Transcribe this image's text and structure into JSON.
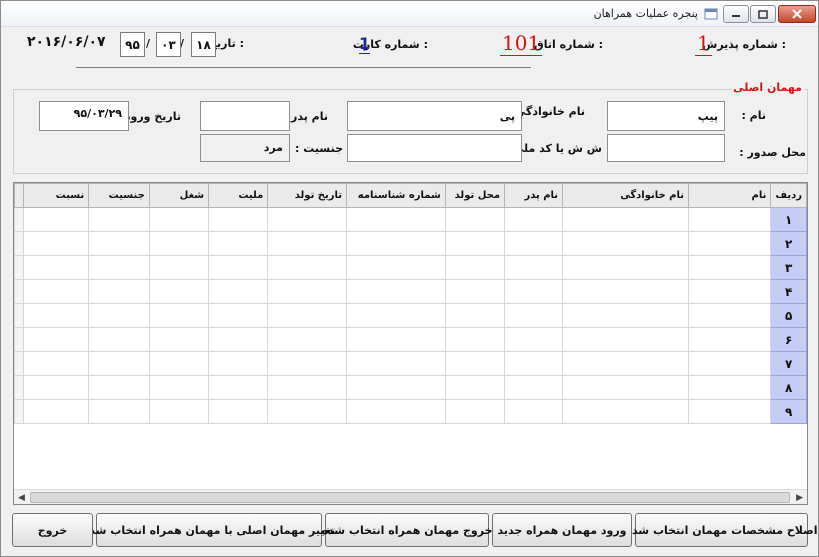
{
  "window": {
    "title": "پنجره عملیات همراهان",
    "icon": "app-icon",
    "controls": {
      "minimize": "minimize-icon",
      "maximize": "maximize-icon",
      "close": "close-icon"
    }
  },
  "header": {
    "reception_label": "شماره پذیرش :",
    "reception_value": "1",
    "room_label": "شماره اتاق :",
    "room_value": "101",
    "card_label": "شماره کارت :",
    "card_value": "1",
    "date_label": "تاریخ :",
    "date_day": "۱۸",
    "date_month": "۰۳",
    "date_year": "۹۵",
    "date_sep": "/",
    "gregorian_date": "۲۰۱۶/۰۶/۰۷"
  },
  "main_guest": {
    "group_title": "مهمان اصلی",
    "first_name_label": "نام :",
    "first_name_value": "پیپ",
    "last_name_label": "نام خانوادگی :",
    "last_name_value": "پی",
    "father_label": "نام پدر :",
    "father_value": "",
    "entry_date_label": "تاریخ ورود :",
    "entry_date_value": "۹۵/۰۳/۲۹",
    "issue_place_label": "محل صدور :",
    "issue_place_value": "",
    "id_label": "ش ش یا کد ملی :",
    "id_value": "",
    "gender_label": "جنسیت :",
    "gender_value": "مرد"
  },
  "grid": {
    "columns": [
      "ردیف",
      "نام",
      "نام خانوادگی",
      "نام پدر",
      "محل تولد",
      "شماره شناسنامه",
      "تاریخ تولد",
      "ملیت",
      "شغل",
      "جنسیت",
      "نسبت"
    ],
    "row_numbers": [
      "۱",
      "۲",
      "۳",
      "۴",
      "۵",
      "۶",
      "۷",
      "۸",
      "۹"
    ]
  },
  "buttons": {
    "edit": "اصلاح مشخصات مهمان انتخاب شده",
    "add": "ورود مهمان همراه جدید",
    "checkout": "خروج مهمان همراه انتخاب شده",
    "swap": "تغییر مهمان اصلی با مهمان همراه انتخاب شده",
    "exit": "خروج"
  },
  "colors": {
    "accent_red": "#d21414",
    "row_header": "#c5cdf4"
  }
}
